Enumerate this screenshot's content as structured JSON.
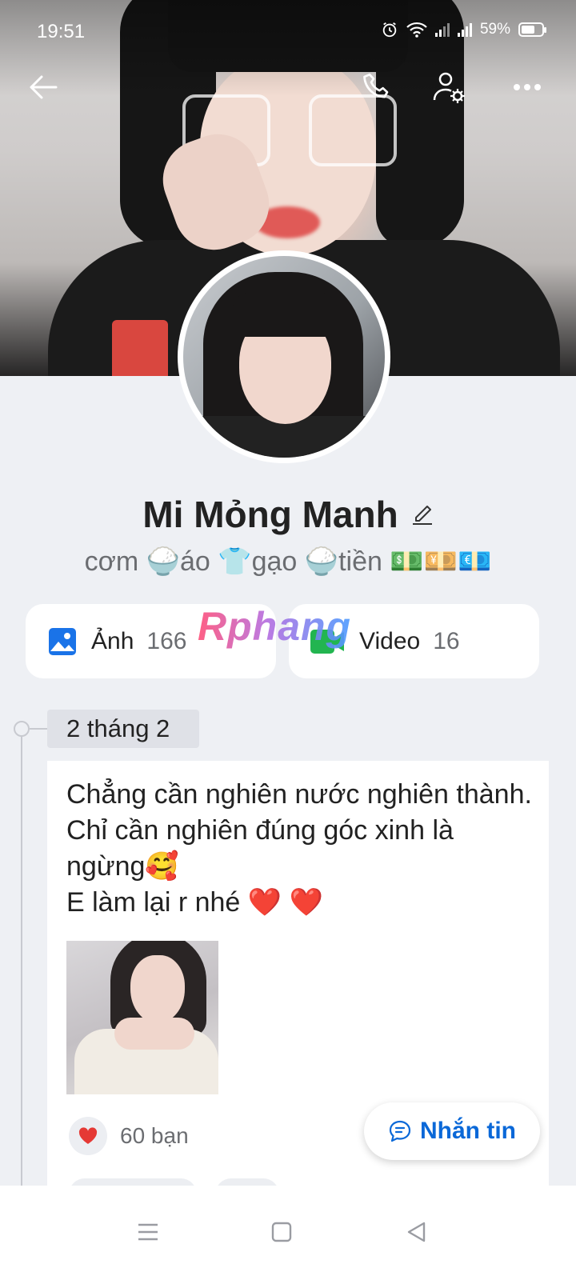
{
  "status_bar": {
    "time": "19:51",
    "battery_percent": "59%"
  },
  "profile": {
    "name": "Mi Mỏng Manh",
    "bio": "cơm 🍚áo 👕gạo 🍚tiền 💵💴💶"
  },
  "media": {
    "photos": {
      "label": "Ảnh",
      "count": "166"
    },
    "videos": {
      "label": "Video",
      "count": "16"
    }
  },
  "watermark": "Rphang",
  "timeline": {
    "date": "2 tháng 2",
    "post": {
      "text": "Chẳng cần nghiên nước nghiên thành. Chỉ cần nghiên đúng góc xinh là ngừng🥰\nE làm lại r nhé ❤️ ❤️",
      "reactions": "60 bạn"
    }
  },
  "message_button": {
    "label": "Nhắn tin"
  },
  "colors": {
    "accent": "#0a68d8",
    "background": "#eef0f4",
    "heart": "#e53935"
  }
}
